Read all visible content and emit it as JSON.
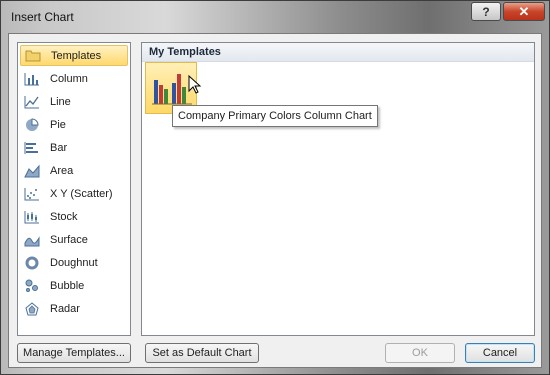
{
  "window": {
    "title": "Insert Chart",
    "help_label": "?",
    "close_label": "✕"
  },
  "sidebar": {
    "items": [
      {
        "label": "Templates",
        "icon": "folder-icon",
        "selected": true
      },
      {
        "label": "Column",
        "icon": "column-chart-icon"
      },
      {
        "label": "Line",
        "icon": "line-chart-icon"
      },
      {
        "label": "Pie",
        "icon": "pie-chart-icon"
      },
      {
        "label": "Bar",
        "icon": "bar-chart-icon"
      },
      {
        "label": "Area",
        "icon": "area-chart-icon"
      },
      {
        "label": "X Y (Scatter)",
        "icon": "scatter-chart-icon"
      },
      {
        "label": "Stock",
        "icon": "stock-chart-icon"
      },
      {
        "label": "Surface",
        "icon": "surface-chart-icon"
      },
      {
        "label": "Doughnut",
        "icon": "doughnut-chart-icon"
      },
      {
        "label": "Bubble",
        "icon": "bubble-chart-icon"
      },
      {
        "label": "Radar",
        "icon": "radar-chart-icon"
      }
    ]
  },
  "main": {
    "section_title": "My Templates",
    "template_tooltip": "Company Primary Colors Column Chart"
  },
  "buttons": {
    "manage_templates": "Manage Templates...",
    "set_default": "Set as Default Chart",
    "ok": "OK",
    "cancel": "Cancel"
  },
  "colors": {
    "selection": "#ffd96e",
    "accent": "#3c7fb1"
  }
}
